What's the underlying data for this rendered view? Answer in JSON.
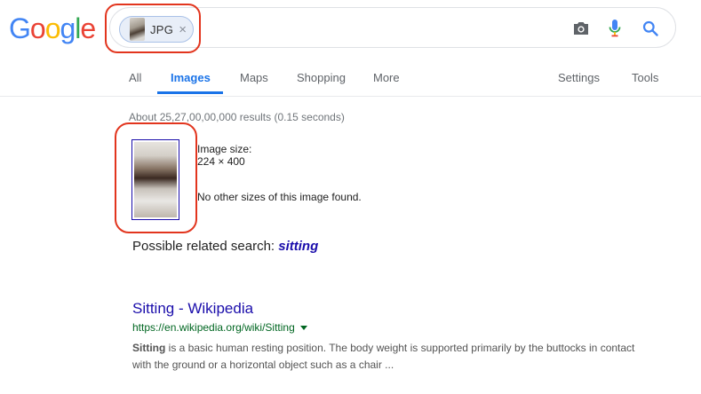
{
  "logo": {
    "letters": [
      "G",
      "o",
      "o",
      "g",
      "l",
      "e"
    ],
    "colors": [
      "#4285f4",
      "#ea4335",
      "#fbbc05",
      "#4285f4",
      "#34a853",
      "#ea4335"
    ]
  },
  "search": {
    "chip_label": "JPG",
    "chip_close": "×",
    "icons": [
      "camera-icon",
      "mic-icon",
      "search-icon"
    ]
  },
  "tabs": [
    {
      "label": "All"
    },
    {
      "label": "Images",
      "active": true
    },
    {
      "label": "Maps"
    },
    {
      "label": "Shopping"
    },
    {
      "label": "More"
    },
    {
      "label": "Settings"
    },
    {
      "label": "Tools"
    }
  ],
  "results_stats": "About 25,27,00,00,000 results (0.15 seconds)",
  "image_info": {
    "size_label": "Image size:",
    "size_value": "224 × 400",
    "no_other_sizes": "No other sizes of this image found."
  },
  "related": {
    "prefix": "Possible related search: ",
    "term": "sitting"
  },
  "result": {
    "title": "Sitting - Wikipedia",
    "url": "https://en.wikipedia.org/wiki/Sitting",
    "snippet_bold": "Sitting",
    "snippet_rest": " is a basic human resting position. The body weight is supported primarily by the buttocks in contact with the ground or a horizontal object such as a chair ..."
  },
  "colors": {
    "accent": "#1a73e8",
    "link": "#1a0dab",
    "url_green": "#006621",
    "annotation_red": "#e2351e"
  }
}
